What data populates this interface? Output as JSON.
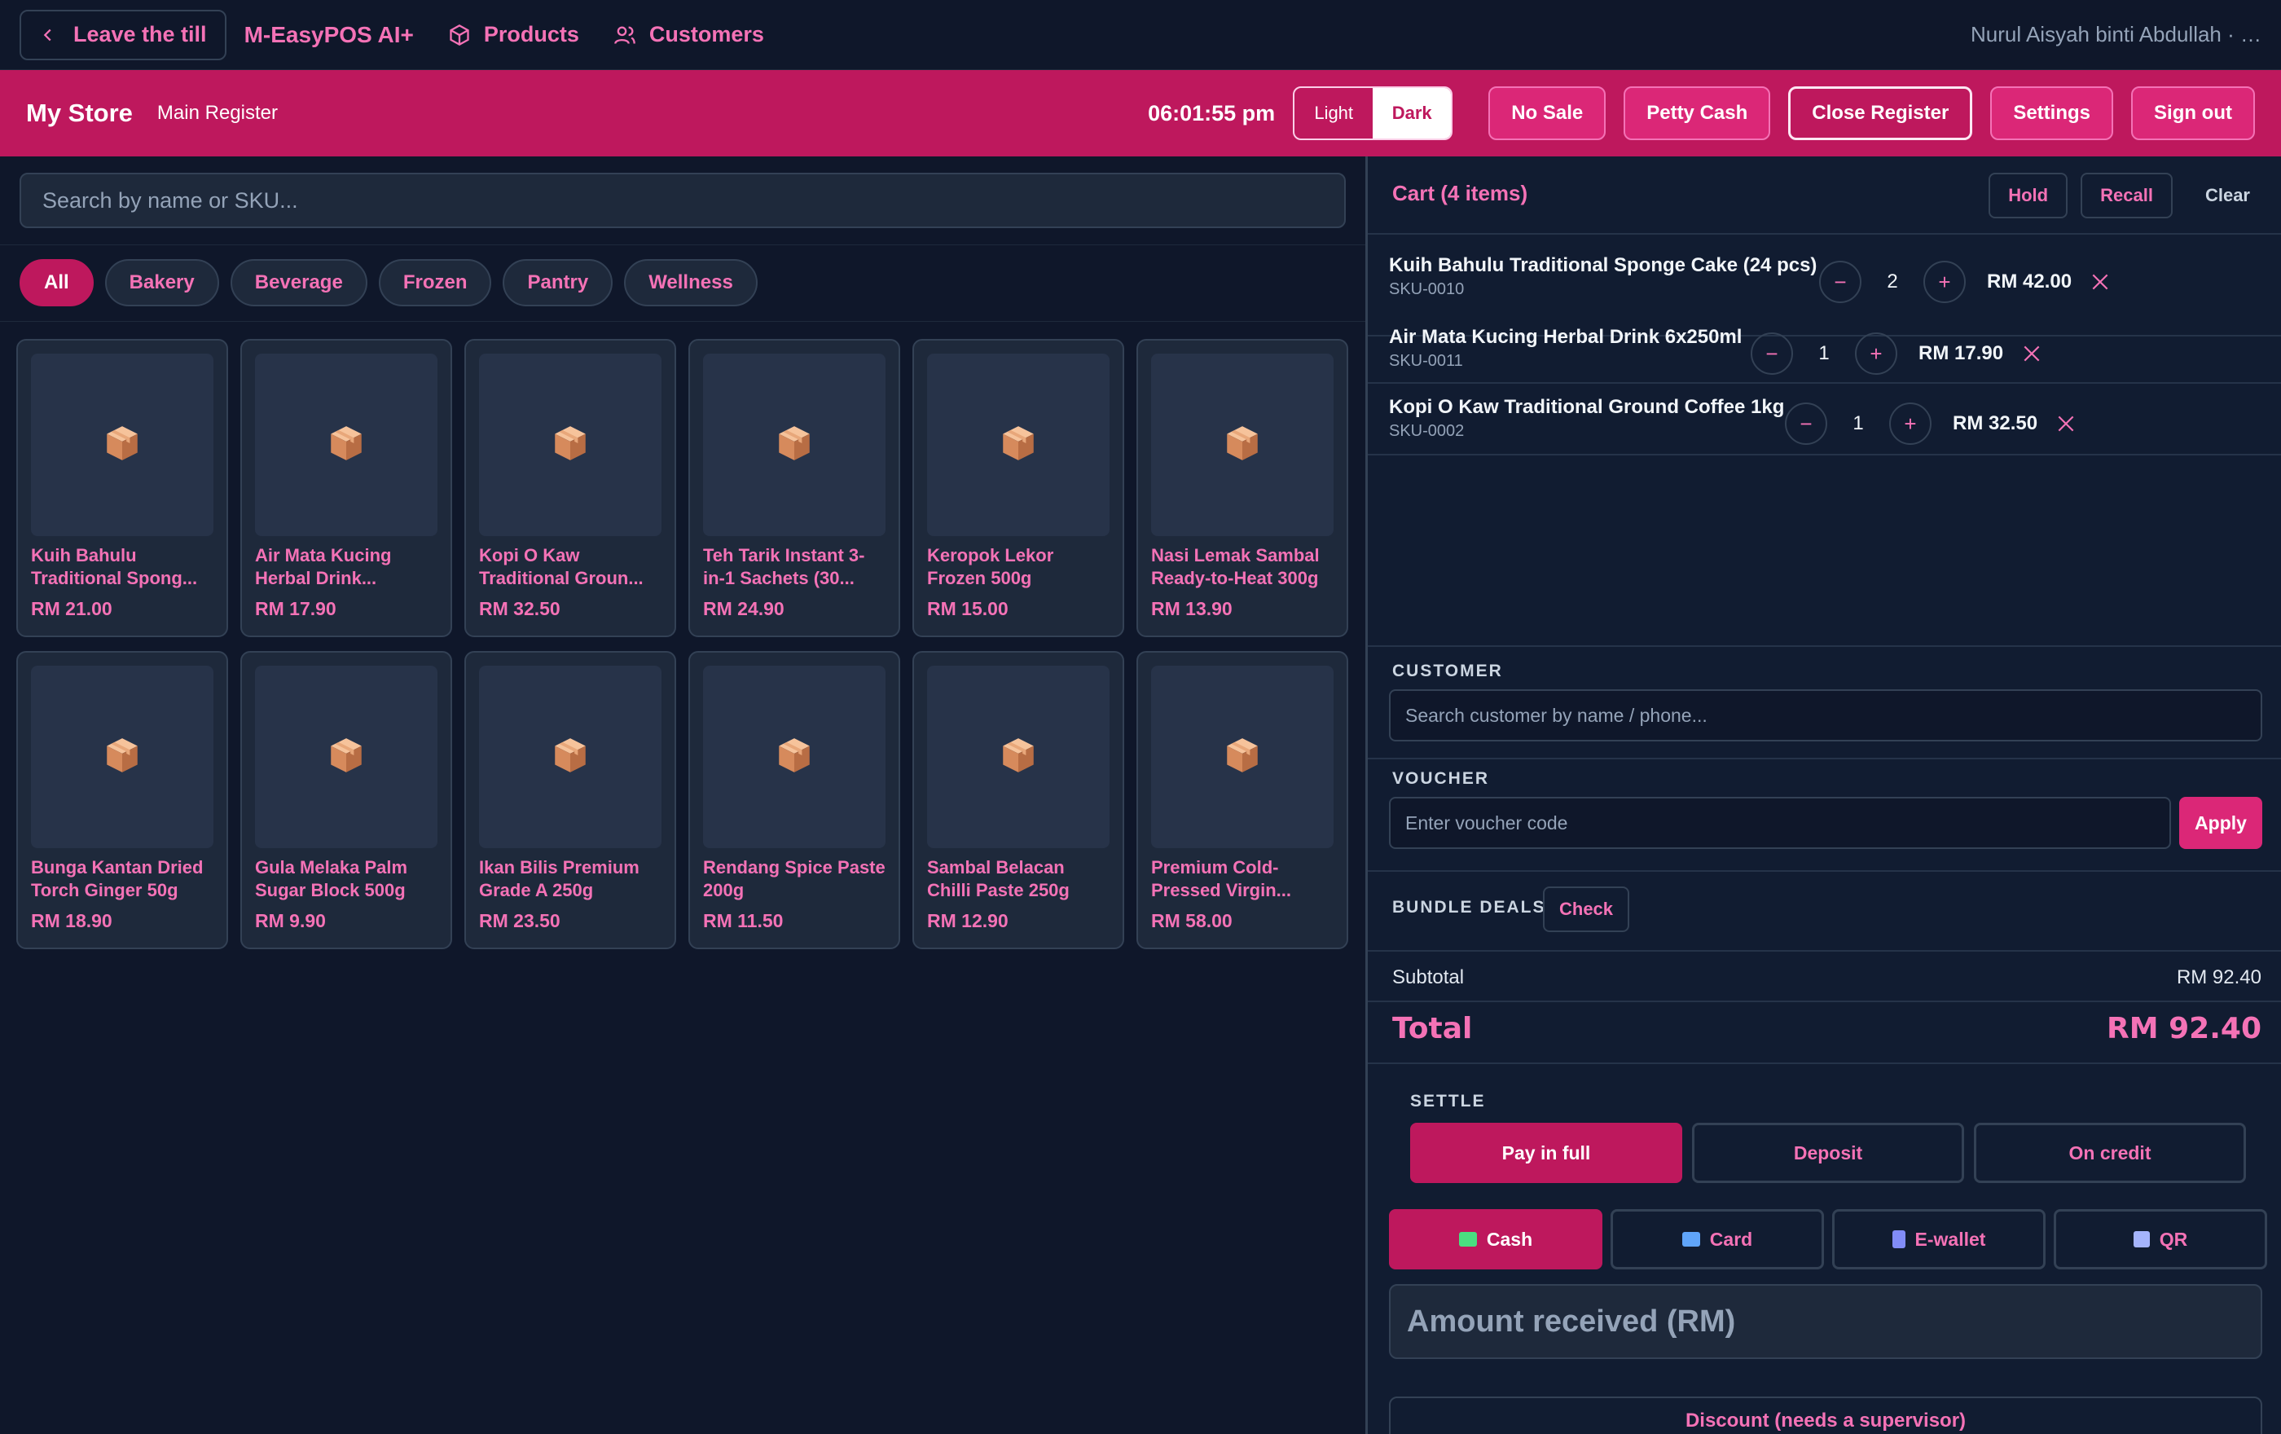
{
  "topbar": {
    "leave_label": "Leave the till",
    "brand": "M-EasyPOS AI+",
    "nav": [
      {
        "label": "Products",
        "icon": "box-icon"
      },
      {
        "label": "Customers",
        "icon": "users-icon"
      }
    ],
    "user": "Nurul Aisyah binti Abdullah · …"
  },
  "storebar": {
    "store": "My Store",
    "register": "Main Register",
    "clock": "06:01:55 pm",
    "theme": {
      "light": "Light",
      "dark": "Dark",
      "selected": "Dark"
    },
    "buttons": {
      "no_sale": "No Sale",
      "petty_cash": "Petty Cash",
      "close_register": "Close Register",
      "settings": "Settings",
      "sign_out": "Sign out"
    }
  },
  "search": {
    "placeholder": "Search by name or SKU..."
  },
  "categories": [
    "All",
    "Bakery",
    "Beverage",
    "Frozen",
    "Pantry",
    "Wellness"
  ],
  "active_category": "All",
  "products": [
    {
      "name": "Kuih Bahulu Traditional Spong...",
      "price": "RM 21.00"
    },
    {
      "name": "Air Mata Kucing Herbal Drink...",
      "price": "RM 17.90"
    },
    {
      "name": "Kopi O Kaw Traditional Groun...",
      "price": "RM 32.50"
    },
    {
      "name": "Teh Tarik Instant 3-in-1 Sachets (30...",
      "price": "RM 24.90"
    },
    {
      "name": "Keropok Lekor Frozen 500g",
      "price": "RM 15.00"
    },
    {
      "name": "Nasi Lemak Sambal Ready-to-Heat 300g",
      "price": "RM 13.90"
    },
    {
      "name": "Bunga Kantan Dried Torch Ginger 50g",
      "price": "RM 18.90"
    },
    {
      "name": "Gula Melaka Palm Sugar Block 500g",
      "price": "RM 9.90"
    },
    {
      "name": "Ikan Bilis Premium Grade A 250g",
      "price": "RM 23.50"
    },
    {
      "name": "Rendang Spice Paste 200g",
      "price": "RM 11.50"
    },
    {
      "name": "Sambal Belacan Chilli Paste 250g",
      "price": "RM 12.90"
    },
    {
      "name": "Premium Cold-Pressed Virgin...",
      "price": "RM 58.00"
    }
  ],
  "cart": {
    "title": "Cart (4 items)",
    "actions": {
      "hold": "Hold",
      "recall": "Recall",
      "clear": "Clear"
    },
    "items": [
      {
        "name": "Kuih Bahulu Traditional Sponge Cake (24 pcs)",
        "sku": "SKU-0010",
        "qty": "2",
        "total": "RM 42.00"
      },
      {
        "name": "Air Mata Kucing Herbal Drink 6x250ml",
        "sku": "SKU-0011",
        "qty": "1",
        "total": "RM 17.90"
      },
      {
        "name": "Kopi O Kaw Traditional Ground Coffee 1kg",
        "sku": "SKU-0002",
        "qty": "1",
        "total": "RM 32.50"
      }
    ],
    "customer_label": "CUSTOMER",
    "customer_placeholder": "Search customer by name / phone...",
    "voucher_label": "VOUCHER",
    "voucher_placeholder": "Enter voucher code",
    "apply": "Apply",
    "bundle_label": "BUNDLE DEALS",
    "check": "Check",
    "subtotal_label": "Subtotal",
    "subtotal": "RM 92.40",
    "total_label": "Total",
    "total": "RM 92.40",
    "settle_label": "SETTLE",
    "settle": [
      "Pay in full",
      "Deposit",
      "On credit"
    ],
    "payment_methods": [
      "Cash",
      "Card",
      "E-wallet",
      "QR"
    ],
    "amount_placeholder": "Amount received (RM)",
    "discount": "Discount (needs a supervisor)"
  },
  "colors": {
    "accent": "#be185d",
    "accent_text": "#f472b6",
    "background": "#0f172a",
    "surface": "#1e293b"
  }
}
